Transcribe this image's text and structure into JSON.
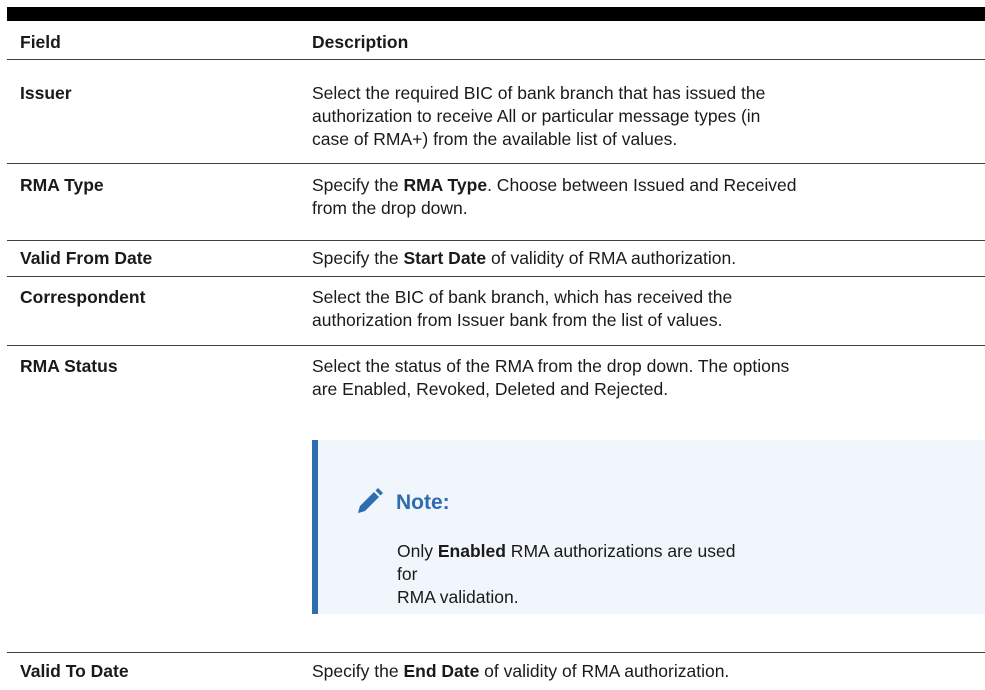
{
  "table": {
    "header": {
      "field": "Field",
      "description": "Description"
    },
    "rows": [
      {
        "field": "Issuer",
        "desc_lines": [
          "Select the required BIC of bank branch that has issued the",
          "authorization to receive All or particular message types (in",
          "case of RMA+) from the available list of values."
        ]
      },
      {
        "field": "RMA Type",
        "desc_pre": "Specify the ",
        "desc_bold": "RMA Type",
        "desc_post": ". Choose between Issued and Received",
        "desc_line2": "from the drop down."
      },
      {
        "field": "Valid From Date",
        "desc_pre": "Specify the ",
        "desc_bold": "Start Date",
        "desc_post": " of validity of RMA authorization."
      },
      {
        "field": "Correspondent",
        "desc_lines": [
          "Select the BIC of bank branch, which has received the",
          "authorization from Issuer bank from the list of values."
        ]
      },
      {
        "field": "RMA Status",
        "desc_lines": [
          "Select the status of the RMA from the drop down. The options",
          "are Enabled, Revoked, Deleted and Rejected."
        ],
        "note": {
          "title": "Note:",
          "icon": "pencil-icon",
          "body_pre": "Only ",
          "body_bold": "Enabled",
          "body_post": " RMA authorizations are used for",
          "body_line2": "RMA validation."
        }
      },
      {
        "field": "Valid To Date",
        "desc_pre": "Specify the ",
        "desc_bold": "End Date",
        "desc_post": " of validity of RMA authorization."
      }
    ]
  },
  "colors": {
    "note_accent": "#2f6cb0",
    "note_background": "#f0f6fb",
    "rule": "#000000"
  }
}
